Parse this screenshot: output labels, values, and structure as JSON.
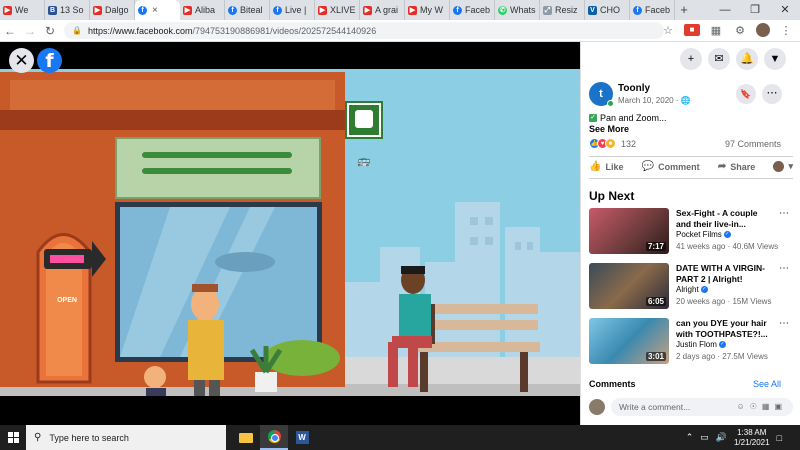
{
  "browser": {
    "tabs": [
      {
        "icon": "youtube-icon",
        "label": "We"
      },
      {
        "icon": "bookmark-icon",
        "label": "13 So"
      },
      {
        "icon": "youtube-icon",
        "label": "Dalgo"
      },
      {
        "icon": "facebook-icon",
        "label": "",
        "active": true
      },
      {
        "icon": "youtube-icon",
        "label": "Aliba"
      },
      {
        "icon": "facebook-icon",
        "label": "Biteal"
      },
      {
        "icon": "facebook-icon",
        "label": "Live |"
      },
      {
        "icon": "youtube-icon",
        "label": "XLIVE"
      },
      {
        "icon": "youtube-icon",
        "label": "A grai"
      },
      {
        "icon": "youtube-icon",
        "label": "My W"
      },
      {
        "icon": "facebook-icon",
        "label": "Faceb"
      },
      {
        "icon": "whatsapp-icon",
        "label": "Whats"
      },
      {
        "icon": "resize-icon",
        "label": "Resiz"
      },
      {
        "icon": "vb-icon",
        "label": "CHO"
      },
      {
        "icon": "facebook-icon",
        "label": "Faceb"
      }
    ],
    "url_host": "https://www.facebook.com",
    "url_path": "/794753190886981/videos/202572544140926"
  },
  "post": {
    "page_name": "Toonly",
    "date": "March 10, 2020 · ",
    "caption": "Pan and Zoom...",
    "see_more": "See More",
    "reaction_count": "132",
    "comment_count": "97 Comments",
    "like_label": "Like",
    "comment_label": "Comment",
    "share_label": "Share"
  },
  "up_next": {
    "heading": "Up Next",
    "items": [
      {
        "title": "Sex-Fight - A couple and their live-in...",
        "channel": "Pocket Films",
        "meta": "41 weeks ago · 40.6M Views",
        "duration": "7:17"
      },
      {
        "title": "DATE WITH A VIRGIN- PART 2 | Alright!",
        "channel": "Alright",
        "meta": "20 weeks ago · 15M Views",
        "duration": "6:05"
      },
      {
        "title": "can you DYE your hair with TOOTHPASTE?!...",
        "channel": "Justin Flom",
        "meta": "2 days ago · 27.5M Views",
        "duration": "3:01"
      }
    ]
  },
  "comments": {
    "heading": "Comments",
    "see_all": "See All",
    "placeholder": "Write a comment..."
  },
  "video": {
    "sign_text": "OPEN"
  },
  "taskbar": {
    "search_placeholder": "Type here to search",
    "time": "1:38 AM",
    "date": "1/21/2021"
  }
}
